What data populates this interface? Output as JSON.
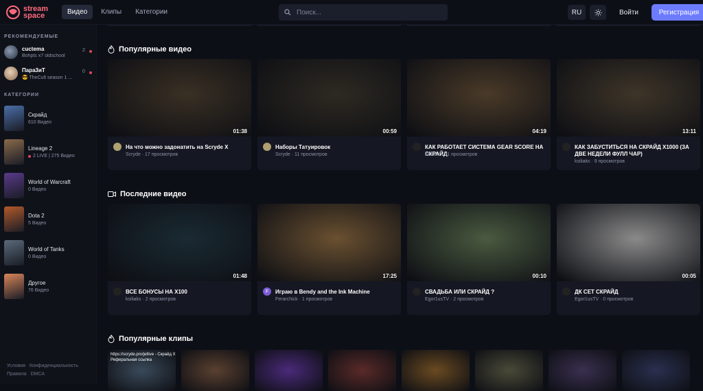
{
  "header": {
    "logo_line1": "stream",
    "logo_line2": "space",
    "nav": [
      "Видео",
      "Клипы",
      "Категории"
    ],
    "search_placeholder": "Поиск...",
    "lang": "RU",
    "login": "Войти",
    "register": "Регистрация"
  },
  "sidebar": {
    "recommended_title": "РЕКОМЕНДУЕМЫЕ",
    "recommended": [
      {
        "name": "cuctema",
        "sub": "Bohpts x7 oldschool",
        "count": "2"
      },
      {
        "name": "Пара3иТ",
        "sub": "😎 TheCult season 1 ...",
        "count": "0"
      }
    ],
    "categories_title": "КАТЕГОРИИ",
    "categories": [
      {
        "name": "Скрайд",
        "sub": "610 Видео",
        "color": "#4a6fa8"
      },
      {
        "name": "Lineage 2",
        "sub": "2 LIVE | 275 Видео",
        "live": true,
        "color": "#8a6a4a"
      },
      {
        "name": "World of Warcraft",
        "sub": "0 Видео",
        "color": "#5a3a8a"
      },
      {
        "name": "Dota 2",
        "sub": "5 Видео",
        "color": "#b35a2a"
      },
      {
        "name": "World of Tanks",
        "sub": "0 Видео",
        "color": "#5a6a7a"
      },
      {
        "name": "Другое",
        "sub": "76 Видео",
        "color": "#d9865a"
      }
    ],
    "footer": [
      "Условия",
      "Конфиденциальность",
      "Правила",
      "DMCA"
    ]
  },
  "sections": {
    "popular_videos": "Популярные видео",
    "latest_videos": "Последние видео",
    "popular_clips": "Популярные клипы"
  },
  "popular": [
    {
      "title": "На что можно задонатить на Scryde X",
      "sub": "Scryde · 17 просмотров",
      "duration": "01:38",
      "color": "#3a3024",
      "av": "#b0a070"
    },
    {
      "title": "Наборы Татуировок",
      "sub": "Scryde · 11 просмотров",
      "duration": "00:59",
      "color": "#2e2a22",
      "av": "#b0a070"
    },
    {
      "title": "КАК РАБОТАЕТ СИСТЕМА GEAR SCORE НА СКРАЙД",
      "sub": "ksiliaks · 11 просмотров",
      "duration": "04:19",
      "color": "#4a3a28",
      "av": "#222"
    },
    {
      "title": "КАК ЗАБУСТИТЬСЯ НА СКРАЙД X1000 (ЗА ДВЕ НЕДЕЛИ ФУЛЛ ЧАР)",
      "sub": "ksiliaks · 9 просмотров",
      "duration": "13:11",
      "color": "#3e3528",
      "av": "#222"
    }
  ],
  "latest": [
    {
      "title": "ВСЕ БОНУСЫ НА Х100",
      "sub": "ksiliaks · 2 просмотров",
      "duration": "01:48",
      "color": "#1a2a33",
      "av": "#222"
    },
    {
      "title": "Играю в Bendy and the Ink Machine",
      "sub": "Ferarchick · 1 просмотров",
      "duration": "17:25",
      "color": "#6a5030",
      "av": "#7a5cd6",
      "av_letter": "F"
    },
    {
      "title": "СВАДЬБА ИЛИ СКРАЙД ?",
      "sub": "Egor1usTV · 2 просмотров",
      "duration": "00:10",
      "color": "#4a5a40",
      "av": "#222"
    },
    {
      "title": "ДК СЕТ СКРАЙД",
      "sub": "Egor1usTV · 0 просмотров",
      "duration": "00:05",
      "color": "#8a8a8a",
      "av": "#222"
    }
  ],
  "clips": [
    {
      "caption": "https://scryde.pro/jetlive - Скрайд Х\nРеферальная ссылка",
      "color": "#3a4a5a"
    },
    {
      "caption": "",
      "color": "#5a4030"
    },
    {
      "caption": "",
      "color": "#4a2a7a"
    },
    {
      "caption": "",
      "color": "#5a2a28"
    },
    {
      "caption": "",
      "color": "#6a4a20"
    },
    {
      "caption": "",
      "color": "#4a4a38"
    },
    {
      "caption": "",
      "color": "#3a3050"
    },
    {
      "caption": "",
      "color": "#2a3050"
    }
  ]
}
